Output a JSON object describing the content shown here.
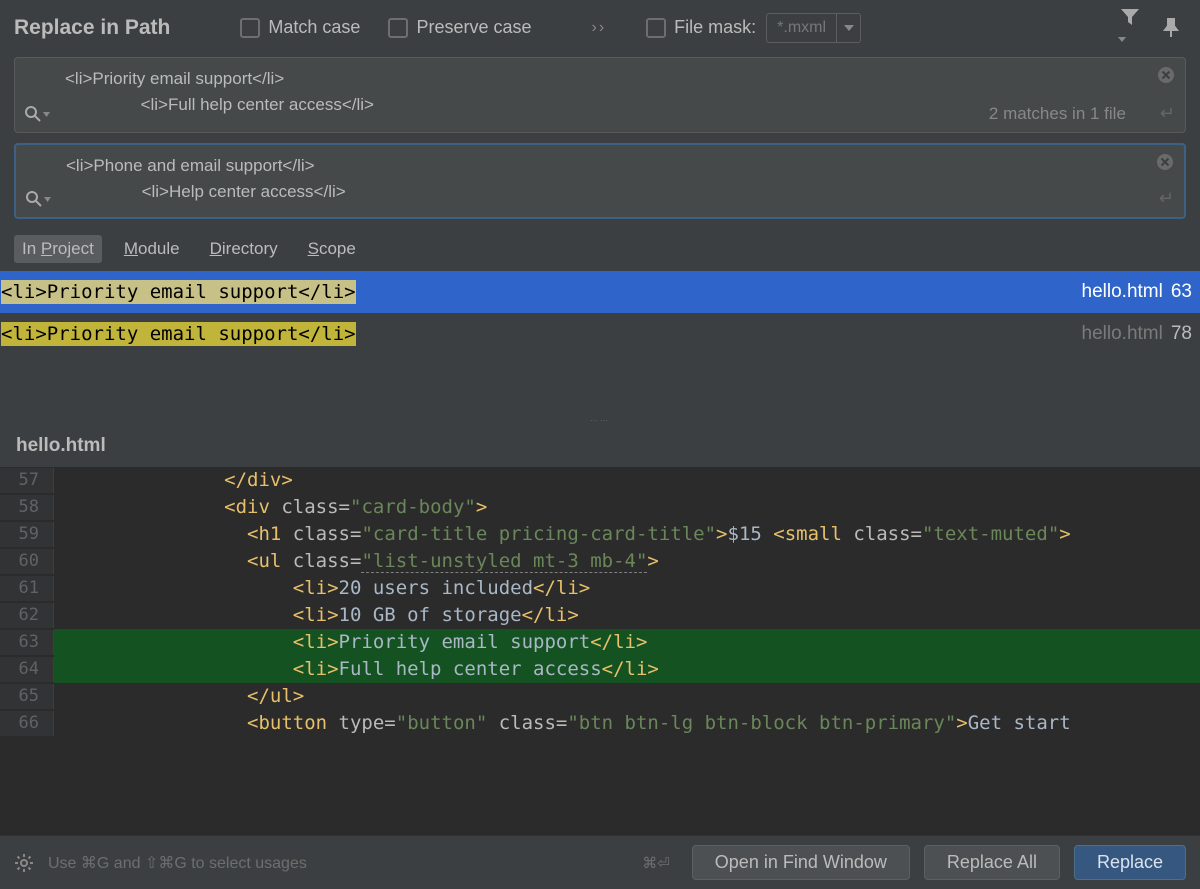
{
  "dialog": {
    "title": "Replace in Path",
    "match_case_label": "Match case",
    "preserve_case_label": "Preserve case",
    "file_mask_label": "File mask:",
    "file_mask_value": "*.mxml"
  },
  "search": {
    "text": "<li>Priority email support</li>\n                <li>Full help center access</li>",
    "match_summary": "2 matches in 1 file"
  },
  "replace": {
    "text": "<li>Phone and email support</li>\n                <li>Help center access</li>"
  },
  "scope_tabs": {
    "in_project": "In Project",
    "module": "Module",
    "directory": "Directory",
    "scope": "Scope"
  },
  "results": [
    {
      "text": "<li>Priority email support</li>",
      "file": "hello.html",
      "line": "63",
      "selected": true
    },
    {
      "text": "<li>Priority email support</li>",
      "file": "hello.html",
      "line": "78",
      "selected": false
    }
  ],
  "preview": {
    "filename": "hello.html",
    "lines": {
      "57": "57",
      "58": "58",
      "59": "59",
      "60": "60",
      "61": "61",
      "62": "62",
      "63": "63",
      "64": "64",
      "65": "65",
      "66": "66"
    },
    "t57": "</div>",
    "c58": {
      "open": "<div ",
      "attr": "class=",
      "val": "\"card-body\"",
      "close": ">"
    },
    "c59": {
      "open": "<h1 ",
      "attr": "class=",
      "val": "\"card-title pricing-card-title\"",
      "close": ">",
      "txt": "$15 ",
      "open2": "<small ",
      "attr2": "class=",
      "val2": "\"text-muted\"",
      "close2": ">"
    },
    "c60": {
      "open": "<ul ",
      "attr": "class=",
      "val": "\"list-unstyled mt-3 mb-4\"",
      "close": ">"
    },
    "c61": {
      "open": "<li>",
      "txt": "20 users included",
      "close": "</li>"
    },
    "c62": {
      "open": "<li>",
      "txt": "10 GB of storage",
      "close": "</li>"
    },
    "c63": {
      "open": "<li>",
      "txt": "Priority email support",
      "close": "</li>"
    },
    "c64": {
      "open": "<li>",
      "txt": "Full help center access",
      "close": "</li>"
    },
    "t65": "</ul>",
    "c66": {
      "open": "<button ",
      "attr1": "type=",
      "val1": "\"button\"",
      "attr2": " class=",
      "val2": "\"btn btn-lg btn-block btn-primary\"",
      "close": ">",
      "txt": "Get start"
    }
  },
  "footer": {
    "hint": "Use ⌘G and ⇧⌘G to select usages",
    "kbd": "⌘⏎",
    "open_find": "Open in Find Window",
    "replace_all": "Replace All",
    "replace": "Replace"
  }
}
